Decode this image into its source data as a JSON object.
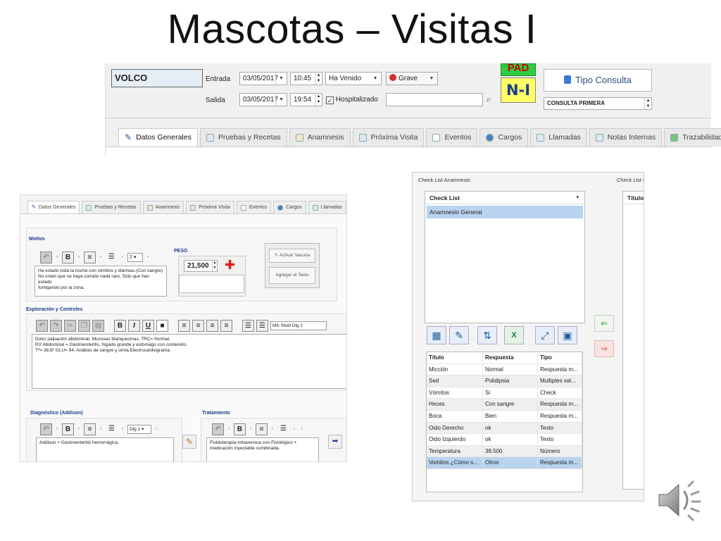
{
  "slide_title": "Mascotas – Visitas I",
  "top": {
    "name_value": "VOLCO",
    "entrada_label": "Entrada",
    "salida_label": "Salida",
    "entrada_date": "03/05/2017",
    "entrada_time": "10:45",
    "salida_date": "03/05/2017",
    "salida_time": "19:54",
    "status_select": "Ha Venido",
    "severity_select": "Grave",
    "hospitalizado_label": "Hospitalizado",
    "badge_pad": "PAD",
    "badge_ni": "N-I",
    "tipo_consulta_button": "Tipo Consulta",
    "tipo_consulta_value": "CONSULTA PRIMERA",
    "tabs": [
      "Datos Generales",
      "Pruebas y Recetas",
      "Anamnesis",
      "Próxima Visita",
      "Eventos",
      "Cargos",
      "Llamadas",
      "Notas Internas",
      "Trazabilidad"
    ]
  },
  "left": {
    "tabs": [
      "Datos Generales",
      "Pruebas y Recetas",
      "Anamnesis",
      "Próxima Visita",
      "Eventos",
      "Cargos",
      "Llamadas"
    ],
    "motivo_label": "Motivo",
    "motivo_text": "Ha estado toda la noche con vómitos y diárreas.(Con sangre)\nNo creen que se haya comido nada raro. Sólo que han estado\nfumigando por la zona.",
    "peso_label": "PESO",
    "peso_value": "21,500",
    "activar_vacuna": "Activar Vacuna",
    "agregar_texto": "Agregar el Texto",
    "exploracion_label": "Exploración y Controles",
    "font_select": "MS Shell Dlg 2",
    "exploracion_text": "Dolor palpación abdominal. Mucosas blanquecinas. TRC= Normal.\nRX Abdominal = Gastroenteritis, hígado grande y estómago con contenido.\nTª= 38,8º GLU= 94. Análisis de sangre y orina.Electrocardiograma.",
    "diagnostico_label": "Diagnóstico (Addison)",
    "diagnostico_text": "Addison + Gastroenteritis hemorrágica.",
    "tratamiento_label": "Tratamiento",
    "tratamiento_text": "Fluidoterapia intravenosa con Fisiológico +\nmedicación inyectable combinada.",
    "size_select": "2",
    "dlg_select": "Dlg 2"
  },
  "right": {
    "panel_title": "Check List Anamnesis",
    "panel_title2": "Check List N",
    "checklist_header": "Check List",
    "checklist_item": "Anamnesis General",
    "right_col_header": "Título",
    "grid_headers": [
      "Título",
      "Respuesta",
      "Tipo"
    ],
    "grid_rows": [
      [
        "Micción",
        "Normal",
        "Respuesta m..."
      ],
      [
        "Sed",
        "Polidipsia",
        "Multiples val..."
      ],
      [
        "Vómitos",
        "Si",
        "Check"
      ],
      [
        "Heces",
        "Con sangre",
        "Respuesta m..."
      ],
      [
        "Boca",
        "Bien",
        "Respuesta m..."
      ],
      [
        "Oido Derecho",
        "ok",
        "Texto"
      ],
      [
        "Oido Izquierdo",
        "ok",
        "Texto"
      ],
      [
        "Temperatura",
        "38.500",
        "Número"
      ],
      [
        "Vomitos ¿Cómo s...",
        "Otros",
        "Respuesta m..."
      ]
    ]
  }
}
